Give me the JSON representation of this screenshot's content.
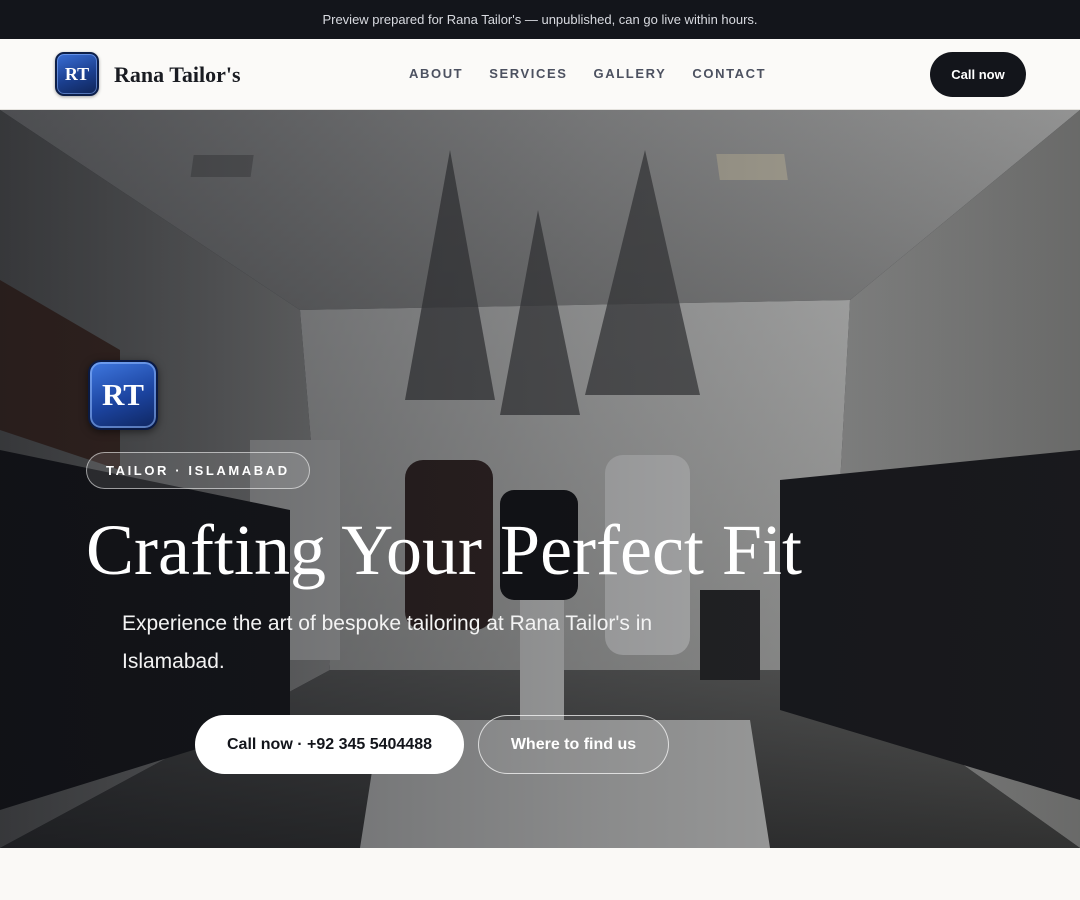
{
  "banner": {
    "text": "Preview prepared for Rana Tailor's — unpublished, can go live within hours."
  },
  "nav": {
    "logo_initials": "RT",
    "brand": "Rana Tailor's",
    "links": [
      "ABOUT",
      "SERVICES",
      "GALLERY",
      "CONTACT"
    ],
    "cta": "Call now"
  },
  "hero": {
    "logo_initials": "RT",
    "badge": "TAILOR · ISLAMABAD",
    "title": "Crafting Your Perfect Fit",
    "subtitle": "Experience the art of bespoke tailoring at Rana Tailor's in Islamabad.",
    "primary_button": "Call now · +92 345 5404488",
    "secondary_button": "Where to find us",
    "background_image": "boutique-interior-photo"
  },
  "colors": {
    "banner_bg": "#13151b",
    "nav_bg": "#fbfaf8",
    "accent_dark": "#13151b",
    "logo_blue": "#1c44a0",
    "page_bg": "#faf9f6"
  }
}
